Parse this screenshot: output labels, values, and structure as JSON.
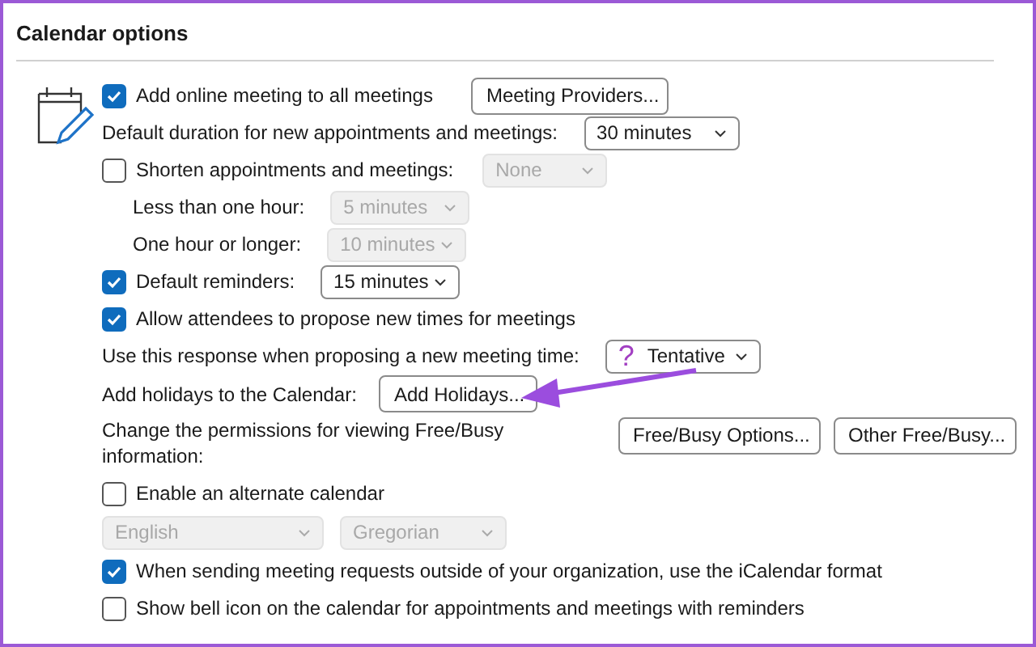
{
  "section": {
    "title": "Calendar options"
  },
  "rows": [
    {
      "kind": "checkbox",
      "label": "Add online meeting to all meetings",
      "checked": true,
      "button": "Meeting Providers..."
    },
    {
      "kind": "dropdown",
      "label": "Default duration for new appointments and meetings:",
      "value": "30 minutes",
      "disabled": false
    },
    {
      "kind": "checkbox",
      "label": "Shorten appointments and meetings:",
      "checked": false,
      "dropdown": {
        "value": "None",
        "disabled": true
      },
      "children": [
        {
          "kind": "dropdown",
          "label": "Less than one hour:",
          "value": "5 minutes",
          "disabled": true
        },
        {
          "kind": "dropdown",
          "label": "One hour or longer:",
          "value": "10 minutes",
          "disabled": true
        }
      ]
    },
    {
      "kind": "checkbox",
      "label": "Default reminders:",
      "checked": true,
      "dropdown": {
        "value": "15 minutes",
        "disabled": false
      }
    },
    {
      "kind": "checkbox",
      "label": "Allow attendees to propose new times for meetings",
      "checked": true
    },
    {
      "kind": "dropdown",
      "label": "Use this response when proposing a new meeting time:",
      "value": "Tentative",
      "icon": "?",
      "disabled": false
    },
    {
      "kind": "button",
      "label": "Add holidays to the Calendar:",
      "buttons": [
        "Add Holidays..."
      ]
    },
    {
      "kind": "button",
      "label": "Change the permissions for viewing Free/Busy information:",
      "buttons": [
        "Free/Busy Options...",
        "Other Free/Busy..."
      ]
    },
    {
      "kind": "checkbox",
      "label": "Enable an alternate calendar",
      "checked": false
    },
    {
      "kind": "pair",
      "values": [
        "English",
        "Gregorian"
      ],
      "disabled": true
    },
    {
      "kind": "checkbox",
      "label": "When sending meeting requests outside of your organization, use the iCalendar format",
      "checked": true
    },
    {
      "kind": "checkbox",
      "label": "Show bell icon on the calendar for appointments and meetings with reminders",
      "checked": false
    }
  ]
}
